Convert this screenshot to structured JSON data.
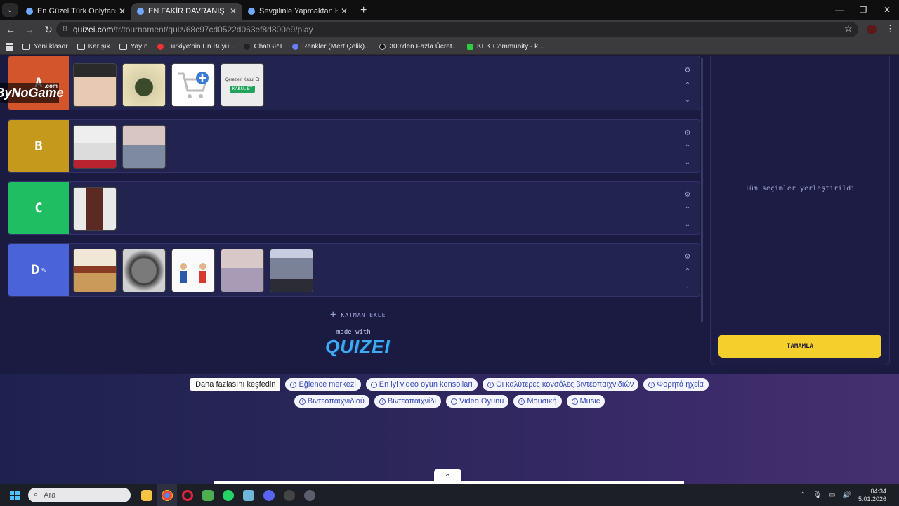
{
  "browser": {
    "tabs": [
      {
        "title": "En Güzel Türk Onlyfansçı - Tier",
        "active": false
      },
      {
        "title": "EN FAKİR DAVRANIŞ - Tier List",
        "active": true
      },
      {
        "title": "Sevgilinle Yapmaktan Hoşlandı",
        "active": false
      }
    ],
    "url_host": "quizei.com",
    "url_path": "/tr/tournament/quiz/68c97cd0522d063ef8d800e9/play",
    "bookmarks": [
      "Yeni klasör",
      "Karışık",
      "Yayın",
      "Türkiye'nin En Büyü...",
      "ChatGPT",
      "Renkler (Mert Çelik)...",
      "300'den Fazla Ücret...",
      "KEK Community - k..."
    ]
  },
  "watermark": {
    "text": "ByNoGame",
    "sub": ".com"
  },
  "tiers": [
    {
      "label": "A",
      "color": "#d2552b",
      "items": [
        "portrait-boy",
        "man-flowers",
        "shopping-cart-plus",
        "cookie-accept-banner"
      ],
      "cookie_title": "Çerezleri Kabul Et",
      "cookie_button": "KABUL ET"
    },
    {
      "label": "B",
      "color": "#c59a1c",
      "items": [
        "man-shirt",
        "pocket-coins"
      ]
    },
    {
      "label": "C",
      "color": "#1fbe62",
      "items": [
        "old-phone"
      ]
    },
    {
      "label": "D",
      "color": "#4a63d9",
      "items": [
        "tea-biscuits",
        "pot-fish",
        "comic-figures",
        "taxi-cartoon",
        "gym-man"
      ]
    }
  ],
  "add_layer_label": "KATMAN EKLE",
  "made_with_label": "made with",
  "brand": "QUIZEI",
  "panel": {
    "message": "Tüm seçimler yerleştirildi",
    "complete_label": "TAMAMLA"
  },
  "explore": {
    "lead": "Daha fazlasını keşfedin",
    "row1": [
      "Eğlence merkezi",
      "En iyi video oyun konsolları",
      "Οι καλύτερες κονσόλες βιντεοπαιχνιδιών",
      "Φορητά ηχεία"
    ],
    "row2": [
      "Βιντεοπαιχνιδιού",
      "Βιντεοπαιχνίδι",
      "Video Oyunu",
      "Μουσική",
      "Music"
    ]
  },
  "taskbar": {
    "search_placeholder": "Ara",
    "time": "04:34",
    "date": "5.01.2026"
  },
  "colors": {
    "accent": "#f5d02c",
    "page_bg": "#1b1b42",
    "row_bg": "#23234f"
  }
}
